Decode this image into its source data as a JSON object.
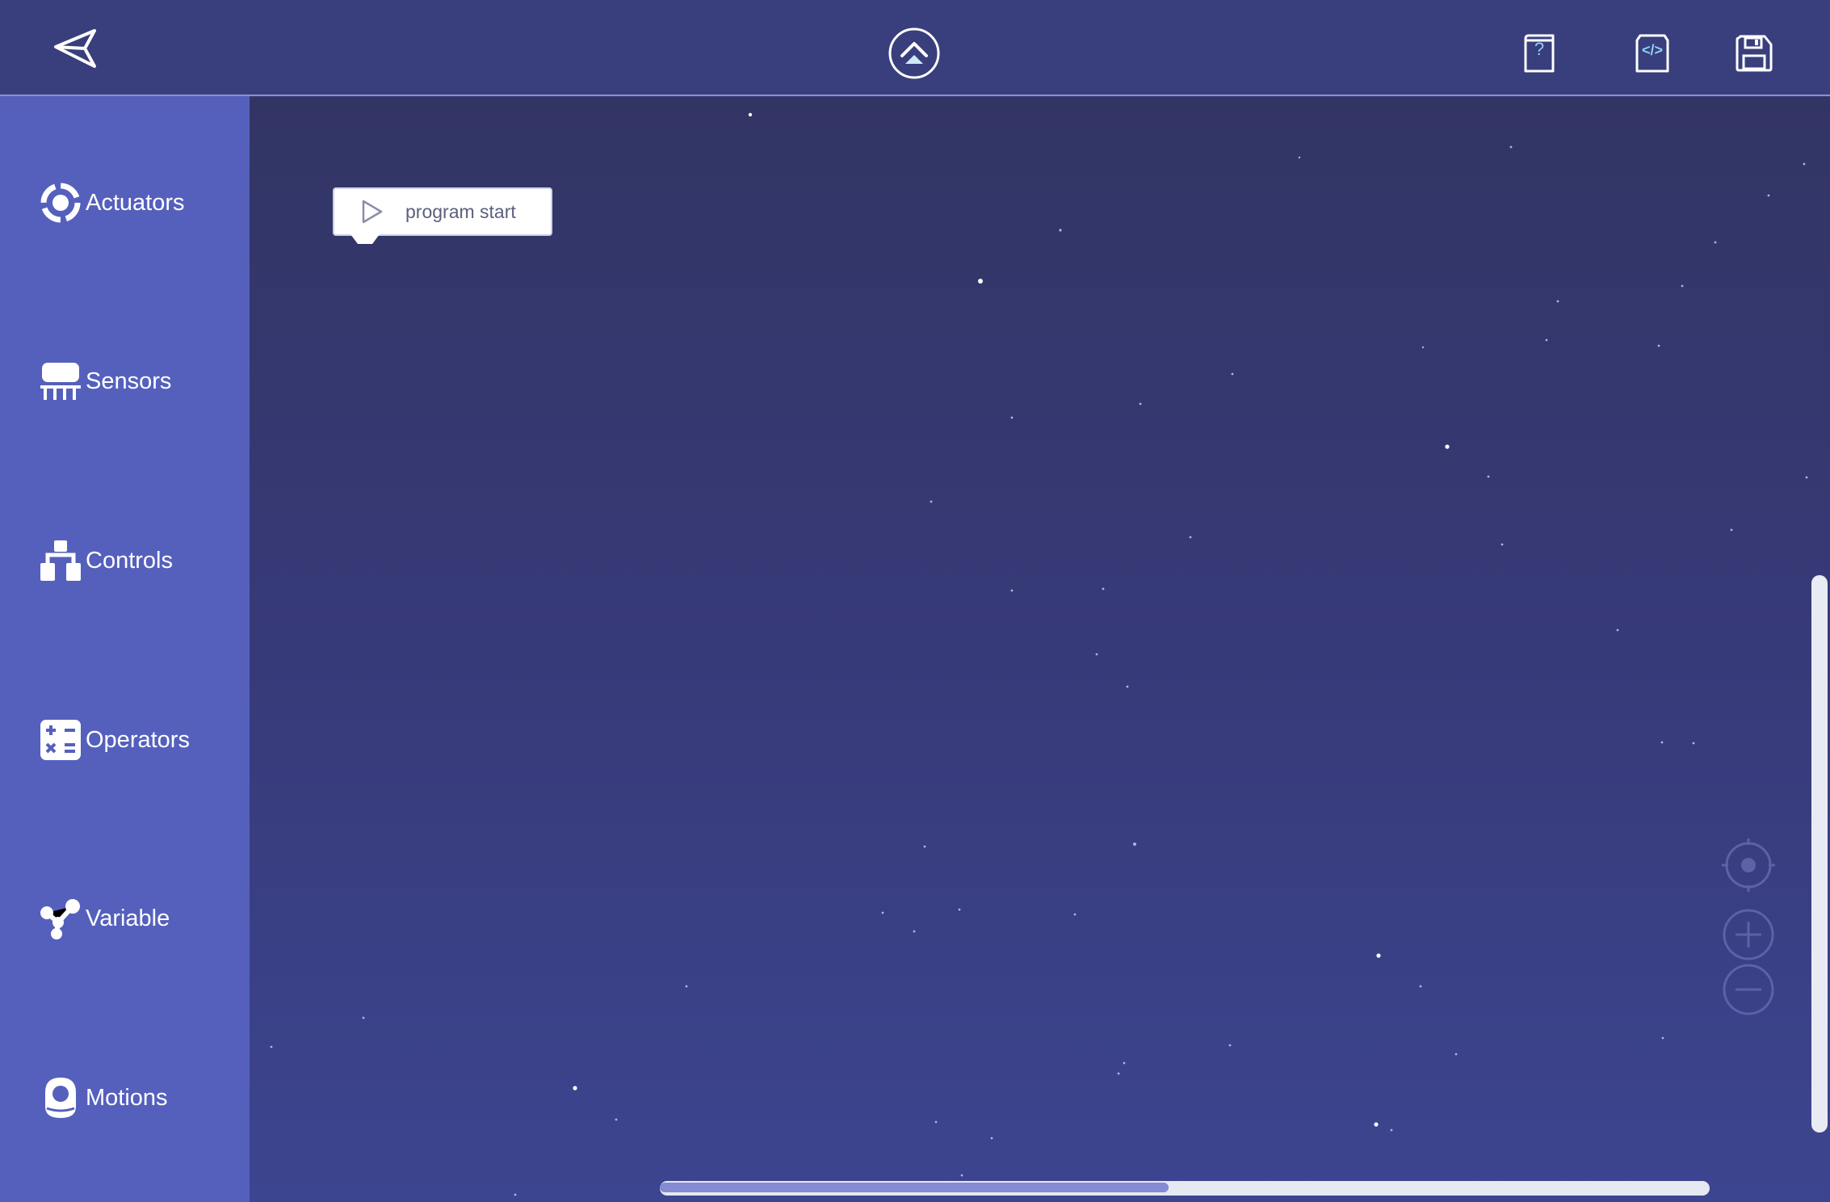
{
  "header": {
    "back_icon": "paper-plane-back-icon",
    "upload_icon": "upload-arrow-icon",
    "help_icon": "help-book-icon",
    "help_glyph": "?",
    "code_icon": "code-file-icon",
    "code_glyph": "</>",
    "save_icon": "floppy-disk-icon"
  },
  "sidebar": {
    "items": [
      {
        "label": "Actuators",
        "icon": "actuator-ring-icon"
      },
      {
        "label": "Sensors",
        "icon": "sensor-chip-icon"
      },
      {
        "label": "Controls",
        "icon": "controls-tree-icon"
      },
      {
        "label": "Operators",
        "icon": "operators-calculator-icon"
      },
      {
        "label": "Variable",
        "icon": "variable-nodes-icon"
      },
      {
        "label": "Motions",
        "icon": "motions-robot-icon"
      }
    ]
  },
  "workspace": {
    "block": {
      "label": "program start",
      "icon": "play-icon"
    },
    "controls": {
      "recenter_icon": "target-icon",
      "zoom_in_icon": "plus-icon",
      "zoom_out_icon": "minus-icon"
    }
  },
  "colors": {
    "header_bg": "#393f7c",
    "sidebar_bg": "#5560bd",
    "workspace_top": "#323564",
    "workspace_bottom": "#3c4590",
    "block_bg": "#ffffff",
    "icon_color": "#ffffff"
  }
}
